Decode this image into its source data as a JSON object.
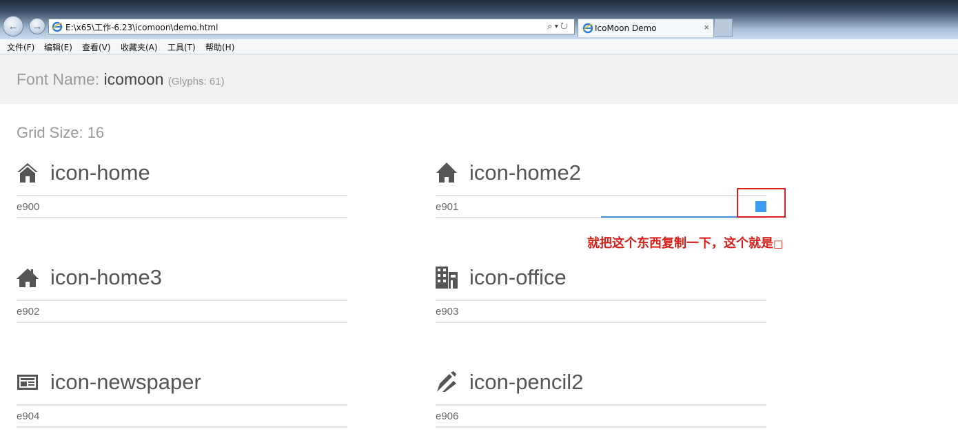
{
  "browser": {
    "url": "E:\\x65\\工作-6.23\\icomoon\\demo.html",
    "tab_title": "IcoMoon Demo",
    "tab_close": "×",
    "menu": [
      "文件(F)",
      "编辑(E)",
      "查看(V)",
      "收藏夹(A)",
      "工具(T)",
      "帮助(H)"
    ]
  },
  "header": {
    "label": "Font Name:",
    "font_name": "icomoon",
    "glyphs": "(Glyphs: 61)"
  },
  "grid_size": "Grid Size: 16",
  "glyphs": [
    {
      "name": "icon-home",
      "code": "e900",
      "icon": "home-icon"
    },
    {
      "name": "icon-home2",
      "code": "e901",
      "icon": "home2-icon"
    },
    {
      "name": "icon-home3",
      "code": "e902",
      "icon": "home3-icon"
    },
    {
      "name": "icon-office",
      "code": "e903",
      "icon": "office-icon"
    },
    {
      "name": "icon-newspaper",
      "code": "e904",
      "icon": "newspaper-icon"
    },
    {
      "name": "icon-pencil2",
      "code": "e906",
      "icon": "pencil2-icon"
    }
  ],
  "annotation": "就把这个东西复制一下，这个就是",
  "colors": {
    "icon": "#555555",
    "annotation": "#d8201a",
    "highlight_square": "#3b9cf3"
  }
}
